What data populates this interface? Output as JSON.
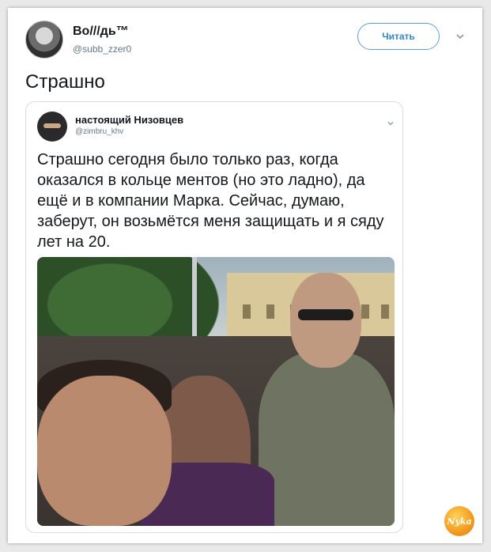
{
  "tweet": {
    "author": {
      "name": "Во///дь™",
      "handle": "@subb_zzer0"
    },
    "follow_label": "Читать",
    "text": "Страшно",
    "quoted": {
      "author": {
        "name": "настоящий Низовцев",
        "handle": "@zimbru_khv"
      },
      "text": "Страшно сегодня было только раз, когда оказался в кольце ментов (но это ладно), да ещё и в компании Марка. Сейчас, думаю, заберут, он возьмётся меня защищать и я сяду лет на 20."
    }
  },
  "watermark": {
    "text": "Nyka"
  },
  "icons": {
    "menu": "chevron-down-icon",
    "quoted_menu": "chevron-down-icon"
  },
  "colors": {
    "accent": "#2f88c8",
    "text": "#14171a",
    "muted": "#657786",
    "border": "#d6dde3",
    "logo": "#f39a1d"
  }
}
